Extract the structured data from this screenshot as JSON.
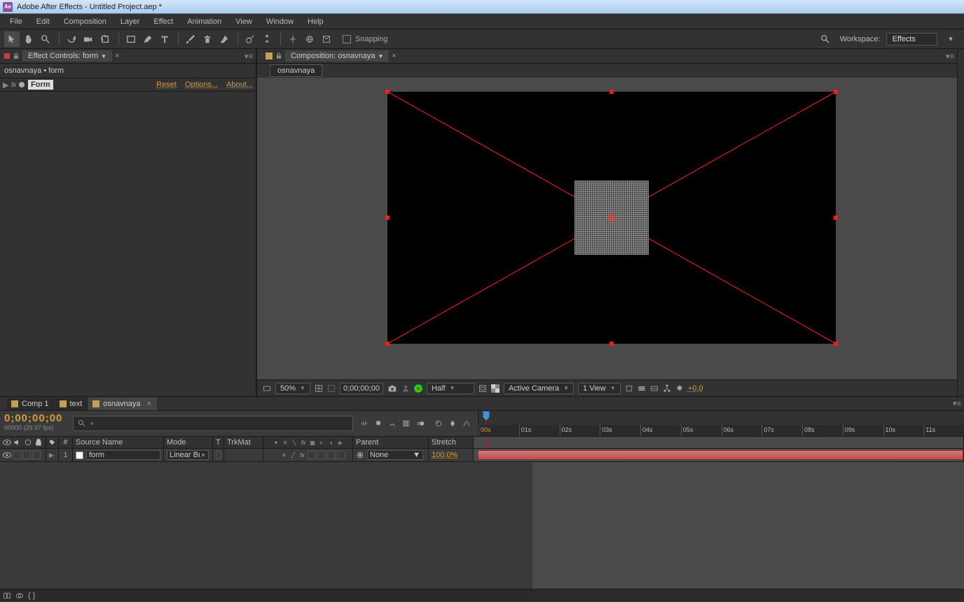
{
  "titlebar": {
    "app": "Ae",
    "text": "Adobe After Effects - Untitled Project.aep *"
  },
  "menu": [
    "File",
    "Edit",
    "Composition",
    "Layer",
    "Effect",
    "Animation",
    "View",
    "Window",
    "Help"
  ],
  "toolbar": {
    "snapping": "Snapping",
    "workspace_label": "Workspace:",
    "workspace_value": "Effects"
  },
  "effectPanel": {
    "tab": "Effect Controls: form",
    "path": "osnavnaya • form",
    "fxName": "Form",
    "links": [
      "Reset",
      "Options...",
      "About..."
    ]
  },
  "compPanel": {
    "tab": "Composition: osnavnaya",
    "subtab": "osnavnaya"
  },
  "compFooter": {
    "zoom": "50%",
    "time": "0;00;00;00",
    "res": "Half",
    "camera": "Active Camera",
    "views": "1 View",
    "exposure": "+0,0"
  },
  "timelineTabs": [
    {
      "name": "Comp 1"
    },
    {
      "name": "text"
    },
    {
      "name": "osnavnaya",
      "active": true
    }
  ],
  "timeline": {
    "bigTime": "0;00;00;00",
    "smallTime": "00000 (29.97 fps)",
    "ruler": [
      "00s",
      "01s",
      "02s",
      "03s",
      "04s",
      "05s",
      "06s",
      "07s",
      "08s",
      "09s",
      "10s",
      "11s"
    ],
    "headers": {
      "num": "#",
      "source": "Source Name",
      "mode": "Mode",
      "t": "T",
      "trk": "TrkMat",
      "parent": "Parent",
      "stretch": "Stretch"
    },
    "layer": {
      "index": "1",
      "name": "form",
      "mode": "Linear Bu",
      "parent": "None",
      "stretch": "100,0%"
    }
  }
}
